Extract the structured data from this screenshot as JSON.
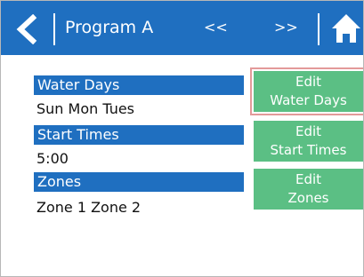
{
  "header": {
    "back_icon": "back-arrow-icon",
    "title": "Program A",
    "prev_label": "<<",
    "next_label": ">>",
    "home_icon": "home-icon"
  },
  "sections": [
    {
      "label": "Water Days",
      "value": "Sun Mon Tues",
      "button_line1": "Edit",
      "button_line2": "Water Days"
    },
    {
      "label": "Start Times",
      "value": "5:00",
      "button_line1": "Edit",
      "button_line2": "Start Times"
    },
    {
      "label": "Zones",
      "value": "Zone 1 Zone 2",
      "button_line1": "Edit",
      "button_line2": "Zones"
    }
  ],
  "colors": {
    "header_bg": "#1f6fc0",
    "label_bg": "#1f6fc0",
    "button_bg": "#5bbf84",
    "focus_outline": "#e39a9a"
  }
}
